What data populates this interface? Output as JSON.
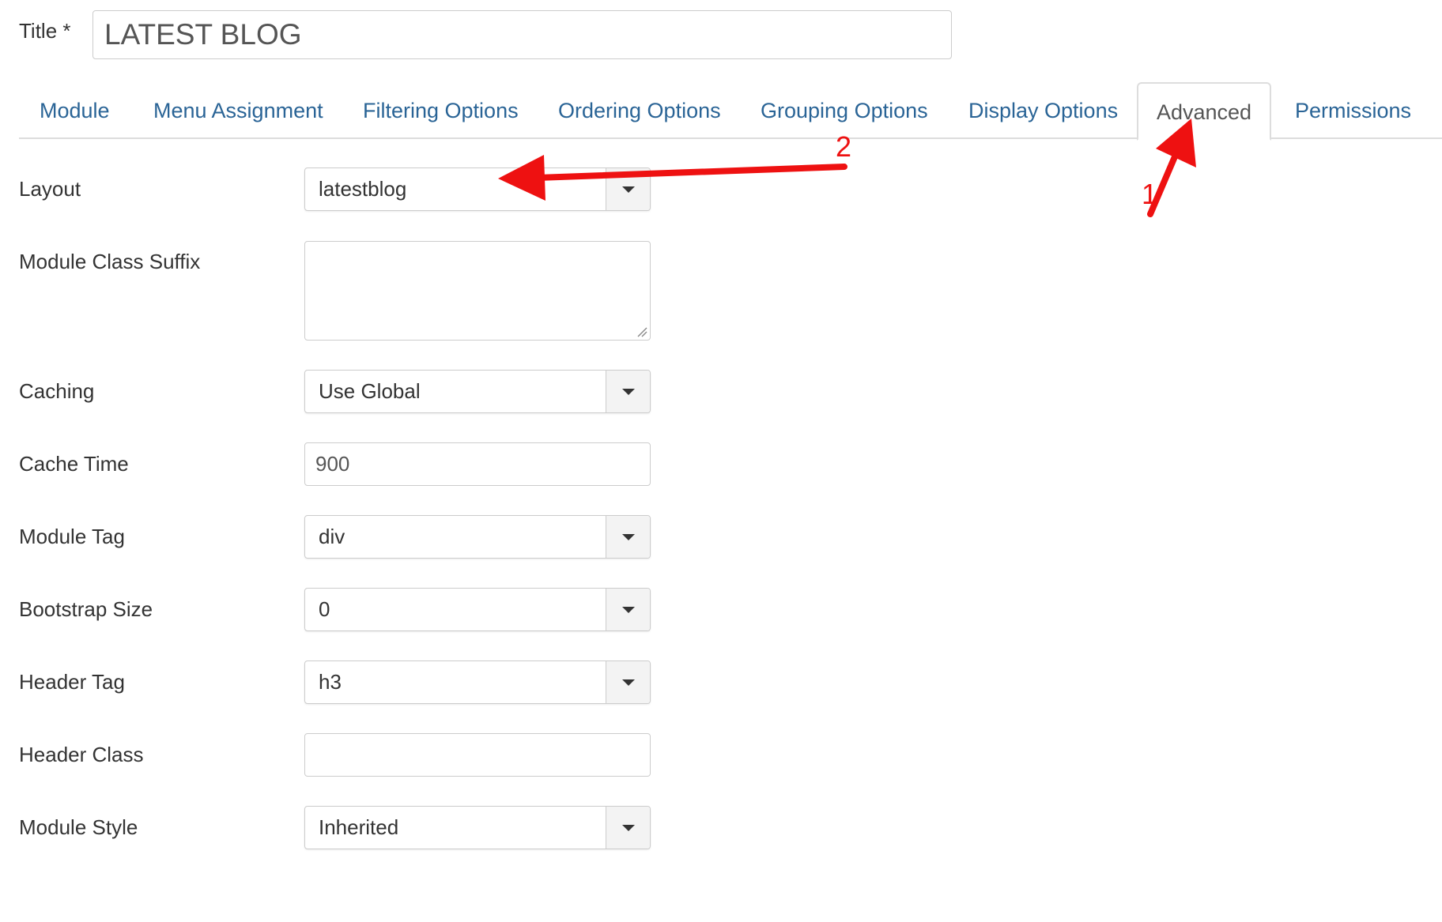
{
  "title": {
    "label": "Title *",
    "value": "LATEST BLOG"
  },
  "tabs": [
    {
      "label": "Module"
    },
    {
      "label": "Menu Assignment"
    },
    {
      "label": "Filtering Options"
    },
    {
      "label": "Ordering Options"
    },
    {
      "label": "Grouping Options"
    },
    {
      "label": "Display Options"
    },
    {
      "label": "Advanced"
    },
    {
      "label": "Permissions"
    }
  ],
  "active_tab": "Advanced",
  "fields": {
    "layout": {
      "label": "Layout",
      "value": "latestblog"
    },
    "module_class_suffix": {
      "label": "Module Class Suffix",
      "value": ""
    },
    "caching": {
      "label": "Caching",
      "value": "Use Global"
    },
    "cache_time": {
      "label": "Cache Time",
      "value": "900"
    },
    "module_tag": {
      "label": "Module Tag",
      "value": "div"
    },
    "bootstrap_size": {
      "label": "Bootstrap Size",
      "value": "0"
    },
    "header_tag": {
      "label": "Header Tag",
      "value": "h3"
    },
    "header_class": {
      "label": "Header Class",
      "value": ""
    },
    "module_style": {
      "label": "Module Style",
      "value": "Inherited"
    }
  },
  "annotations": {
    "step1": "1",
    "step2": "2",
    "color": "#ee1111"
  },
  "colors": {
    "link": "#2a6496",
    "active_tab_text": "#555555",
    "border": "#cccccc"
  },
  "icons": {
    "dropdown": "caret-down-icon",
    "resize": "resize-handle-icon",
    "annotation_arrow": "red-arrow-icon"
  }
}
